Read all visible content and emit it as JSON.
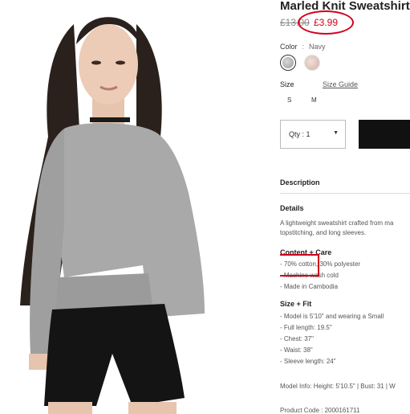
{
  "product": {
    "title": "Marled Knit Sweatshirt",
    "price_original": "£13.00",
    "price_sale": "£3.99"
  },
  "color": {
    "label": "Color",
    "separator": ":",
    "selected_name": "Navy",
    "swatches": [
      "heather-grey-swatch",
      "blush-swatch"
    ]
  },
  "size": {
    "label": "Size",
    "guide_link": "Size Guide",
    "options": [
      "S",
      "M"
    ]
  },
  "quantity": {
    "label": "Qty : 1"
  },
  "description": {
    "heading": "Description",
    "details_heading": "Details",
    "details_text": [
      "A lightweight sweatshirt crafted from ma",
      "topstitching, and long sleeves."
    ],
    "content_heading": "Content + Care",
    "content_lines": [
      "- 70% cotton, 30% polyester",
      "- Machine wash cold",
      "- Made in Cambodia"
    ],
    "fit_heading": "Size + Fit",
    "fit_lines": [
      "- Model is 5'10\" and wearing a Small",
      "- Full length: 19.5\"",
      "- Chest: 37\"",
      "- Waist: 38\"",
      "- Sleeve length: 24\""
    ],
    "model_info": "Model Info: Height: 5'10.5\" | Bust: 31 | W",
    "product_code": "Product Code : 2000161711"
  },
  "colors": {
    "highlight": "#d0021b",
    "sweater": "#a9a9a9",
    "shorts": "#141414",
    "button": "#111111"
  }
}
